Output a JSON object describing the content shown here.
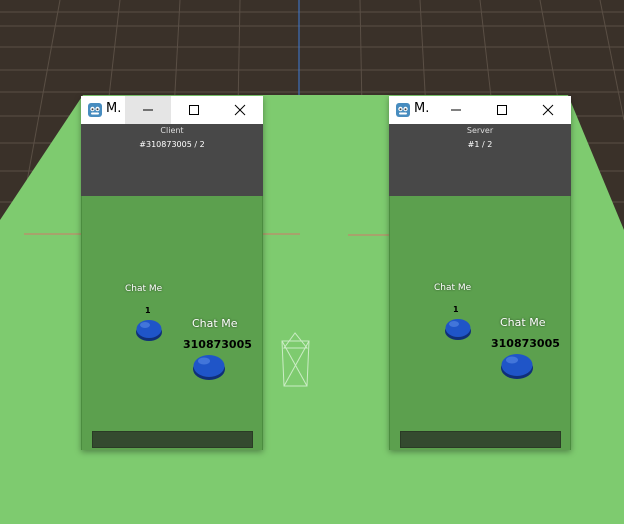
{
  "colors": {
    "ground": "#7ecb6f",
    "sky_grid": "#3a3129",
    "window_panel": "#484848",
    "game_view": "#5ca04e",
    "player": "#1f55c8",
    "input_bar": "#344a2f"
  },
  "windows": [
    {
      "title": "M.",
      "role_label": "Client",
      "id_label": "#310873005 / 2",
      "local_player": {
        "chat_label": "Chat Me",
        "number": "1"
      },
      "remote_player": {
        "chat_label": "Chat Me",
        "number": "310873005"
      },
      "minimize_hovered": true
    },
    {
      "title": "M.",
      "role_label": "Server",
      "id_label": "#1 / 2",
      "local_player": {
        "chat_label": "Chat Me",
        "number": "1"
      },
      "remote_player": {
        "chat_label": "Chat Me",
        "number": "310873005"
      },
      "minimize_hovered": false
    }
  ],
  "icons": {
    "app": "godot-icon",
    "minimize": "minimize-icon",
    "maximize": "maximize-icon",
    "close": "close-icon",
    "camera": "camera-gizmo-icon"
  }
}
